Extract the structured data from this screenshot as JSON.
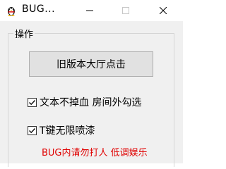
{
  "window": {
    "title": "BUG...",
    "icon": "penguin-icon"
  },
  "title_buttons": {
    "minimize_icon": "minimize-icon",
    "maximize_icon": "maximize-icon",
    "close_icon": "close-icon"
  },
  "group": {
    "label": "操作",
    "button_label": "旧版本大厅点击",
    "checkboxes": [
      {
        "label": "文本不掉血 房间外勾选",
        "checked": true
      },
      {
        "label": "T键无限喷漆",
        "checked": true
      }
    ],
    "note": "BUG内请勿打人 低调娱乐"
  },
  "colors": {
    "note": "#e00000",
    "background": "#f0f0f0",
    "titlebar": "#ffffff"
  }
}
